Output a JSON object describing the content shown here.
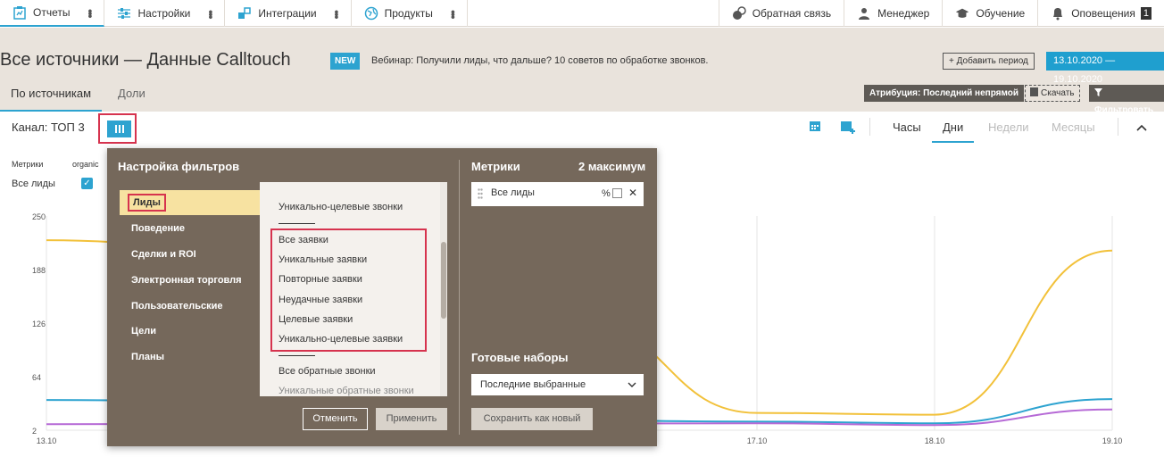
{
  "topnav": {
    "reports": "Отчеты",
    "settings": "Настройки",
    "integrations": "Интеграции",
    "products": "Продукты",
    "feedback": "Обратная связь",
    "manager": "Менеджер",
    "training": "Обучение",
    "notifications": "Оповещения",
    "notifications_count": "1"
  },
  "header": {
    "title": "Все источники — Данные Calltouch",
    "new_badge": "NEW",
    "webinar": "Вебинар: Получили лиды, что дальше? 10 советов по обработке звонков.",
    "add_period": "+ Добавить период",
    "date_range": "13.10.2020  —  19.10.2020",
    "tab_by_source": "По источникам",
    "tab_shares": "Доли",
    "attribution": "Атрибуция: Последний непрямой",
    "download": "Скачать",
    "filter": "Фильтровать"
  },
  "controls": {
    "channel": "Канал: ТОП 3",
    "hours": "Часы",
    "days": "Дни",
    "weeks": "Недели",
    "months": "Месяцы",
    "metrics_label": "Метрики",
    "organic_label": "organic",
    "all_leads": "Все лиды"
  },
  "filter_panel": {
    "title": "Настройка фильтров",
    "categories": [
      "Лиды",
      "Поведение",
      "Сделки и ROI",
      "Электронная торговля",
      "Пользовательские",
      "Цели",
      "Планы"
    ],
    "sub_items": {
      "top": "Уникально-целевые звонки",
      "requests": [
        "Все заявки",
        "Уникальные заявки",
        "Повторные заявки",
        "Неудачные заявки",
        "Целевые заявки",
        "Уникально-целевые заявки"
      ],
      "callbacks": [
        "Все обратные звонки",
        "Уникальные обратные звонки"
      ]
    },
    "cancel": "Отменить",
    "apply": "Применить",
    "metrics_title": "Метрики",
    "max_label": "2 максимум",
    "selected_metric": "Все лиды",
    "pct": "%",
    "presets_title": "Готовые наборы",
    "preset_value": "Последние выбранные",
    "save_new": "Сохранить как новый"
  },
  "chart_data": {
    "type": "line",
    "y_ticks": [
      "250",
      "188",
      "126",
      "64",
      "2"
    ],
    "x_ticks": [
      "13.10",
      "17.10",
      "18.10",
      "19.10"
    ],
    "ylim": [
      2,
      250
    ],
    "series": [
      {
        "color": "#f2c13a",
        "x": [
          "13.10",
          "16.10",
          "17.10",
          "18.10",
          "19.10"
        ],
        "values": [
          222,
          126,
          22,
          20,
          210
        ]
      },
      {
        "color": "#2da3d0",
        "x": [
          "13.10",
          "17.10",
          "18.10",
          "19.10"
        ],
        "values": [
          37,
          12,
          10,
          38
        ]
      },
      {
        "color": "#b66ad6",
        "x": [
          "13.10",
          "17.10",
          "18.10",
          "19.10"
        ],
        "values": [
          9,
          10,
          8,
          26
        ]
      }
    ]
  }
}
